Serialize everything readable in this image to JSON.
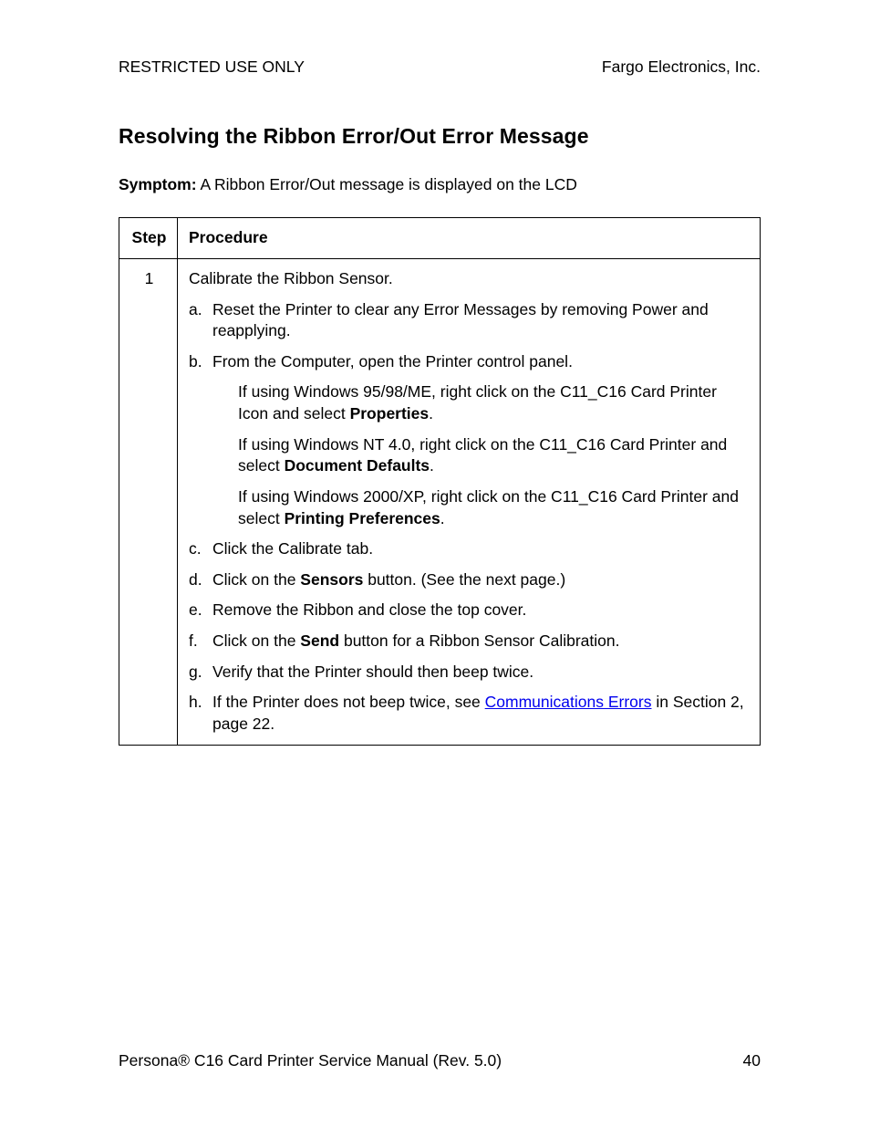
{
  "header": {
    "left": "RESTRICTED USE ONLY",
    "right": "Fargo Electronics, Inc."
  },
  "heading": "Resolving the Ribbon Error/Out Error Message",
  "symptom": {
    "label": "Symptom:",
    "text": " A Ribbon Error/Out message is displayed on the LCD"
  },
  "table": {
    "col1": "Step",
    "col2": "Procedure",
    "step": "1",
    "intro": "Calibrate the Ribbon Sensor.",
    "a": {
      "m": "a.",
      "t": "Reset the Printer to clear any Error Messages by removing Power and reapplying."
    },
    "b": {
      "m": "b.",
      "t": "From the Computer, open the Printer control panel."
    },
    "b1": {
      "pre": "If using Windows 95/98/ME, right click on the C11_C16 Card Printer Icon and select ",
      "bold": "Properties",
      "post": "."
    },
    "b2": {
      "pre": "If using Windows NT 4.0, right click on the C11_C16 Card Printer and select ",
      "bold": "Document Defaults",
      "post": "."
    },
    "b3": {
      "pre": "If using Windows 2000/XP, right click on the C11_C16 Card Printer and select ",
      "bold": "Printing Preferences",
      "post": "."
    },
    "c": {
      "m": "c.",
      "t": "Click the Calibrate tab."
    },
    "d": {
      "m": "d.",
      "pre": "Click on the ",
      "bold": "Sensors",
      "post": " button. (See the next page.)"
    },
    "e": {
      "m": "e.",
      "t": "Remove the Ribbon and close the top cover."
    },
    "f": {
      "m": "f.",
      "pre": "Click on the ",
      "bold": "Send",
      "post": " button for a Ribbon Sensor Calibration."
    },
    "g": {
      "m": "g.",
      "t": "Verify that the Printer should then beep twice."
    },
    "h": {
      "m": "h.",
      "pre": "If the Printer does not beep twice, see ",
      "link": "Communications Errors",
      "post": " in Section 2, page 22."
    }
  },
  "footer": {
    "left": "Persona® C16 Card Printer Service Manual (Rev. 5.0)",
    "right": "40"
  }
}
